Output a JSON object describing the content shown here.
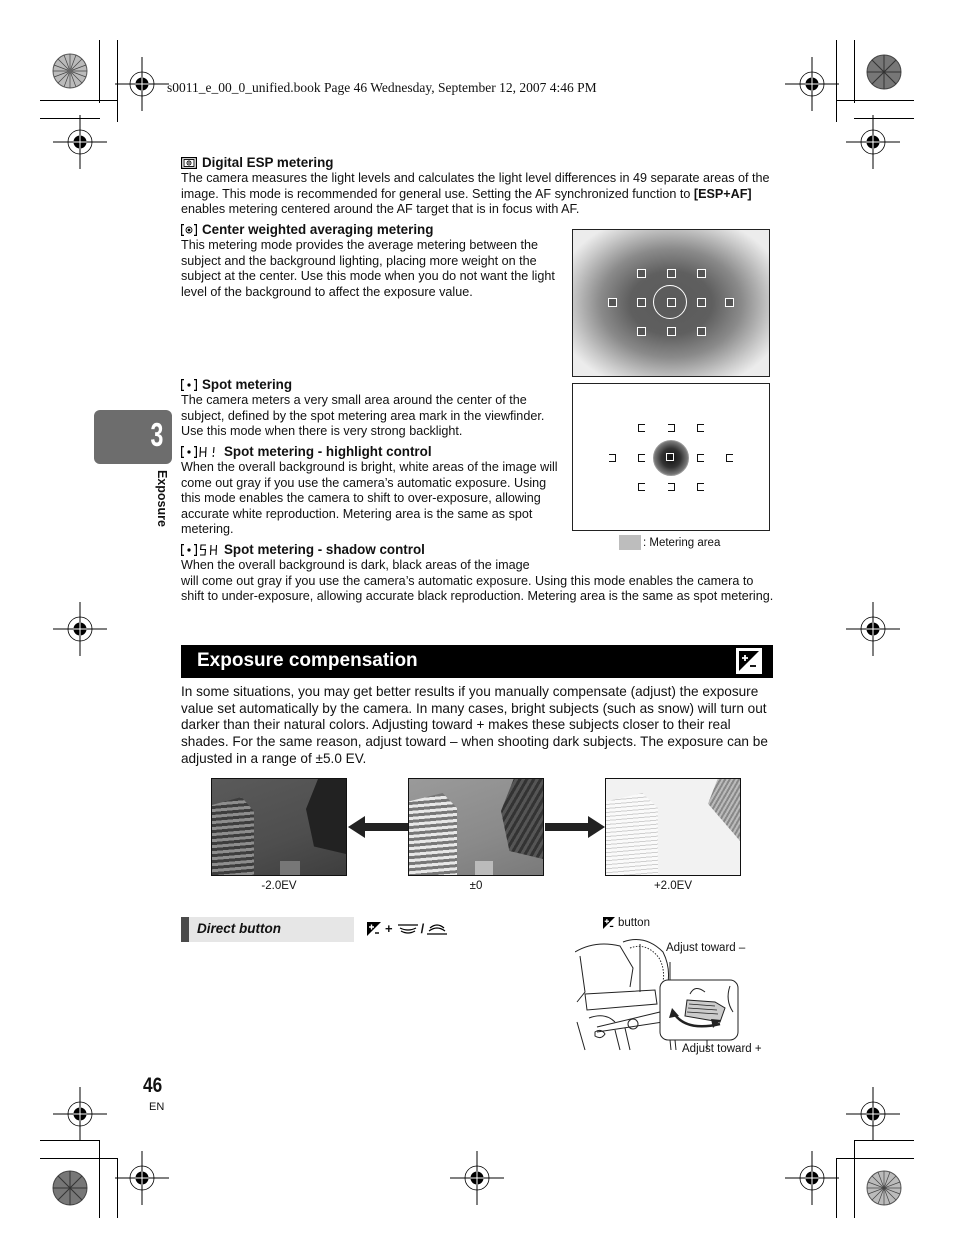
{
  "print_header": {
    "book_line": "s0011_e_00_0_unified.book  Page 46  Wednesday, September 12, 2007  4:46 PM"
  },
  "chapter_tab": {
    "number": "3",
    "label": "Exposure"
  },
  "metering_modes": [
    {
      "icon": "digital-esp-metering-icon",
      "title": "Digital ESP metering",
      "body_parts": [
        "The camera measures the light levels and calculates the light level differences in 49 separate areas of the image. This mode is recommended for general use. Setting the AF synchronized function to ",
        "[ESP+AF]",
        " enables metering centered around the AF target that is in focus with AF."
      ]
    },
    {
      "icon": "center-weighted-metering-icon",
      "title": "Center weighted averaging metering",
      "body": "This metering mode provides the average metering between the subject and the background lighting, placing more weight on the subject at the center. Use this mode when you do not want the light level of the background to affect the exposure value."
    },
    {
      "icon": "spot-metering-icon",
      "title": "Spot metering",
      "body": "The camera meters a very small area around the center of the subject, defined by the spot metering area mark in the viewfinder. Use this mode when there is very strong backlight."
    },
    {
      "icon": "spot-highlight-icon",
      "icon_suffix": "HI",
      "title": "Spot metering - highlight control",
      "body": "When the overall background is bright, white areas of the image will come out gray if you use the camera’s automatic exposure. Using this mode enables the camera to shift to over-exposure, allowing accurate white reproduction. Metering area is the same as spot metering."
    },
    {
      "icon": "spot-shadow-icon",
      "icon_suffix": "SH",
      "title": "Spot metering - shadow control",
      "body_line1": "When the overall background is dark, black areas of the image",
      "body_rest": "will come out gray if you use the camera’s automatic exposure. Using this mode enables the camera to shift to under-exposure, allowing accurate black reproduction. Metering area is the same as spot metering."
    }
  ],
  "diagram_legend": ": Metering area",
  "exposure_section": {
    "title": "Exposure compensation",
    "icon": "exposure-compensation-icon",
    "body": "In some situations, you may get better results if you manually compensate (adjust) the exposure value set automatically by the camera. In many cases, bright subjects (such as snow) will turn out darker than their natural colors. Adjusting toward + makes these subjects closer to their real shades. For the same reason, adjust toward – when shooting dark subjects. The exposure can be adjusted in a range of ±5.0 EV.",
    "examples": [
      {
        "caption": "-2.0EV"
      },
      {
        "caption": "±0"
      },
      {
        "caption": "+2.0EV"
      }
    ]
  },
  "direct_button": {
    "label": "Direct button",
    "combo_plus": "+",
    "combo_slash": "/"
  },
  "camera_figure": {
    "button_label": "button",
    "adjust_minus": "Adjust toward –",
    "adjust_plus": "Adjust toward +"
  },
  "footer": {
    "page_number": "46",
    "language": "EN"
  }
}
